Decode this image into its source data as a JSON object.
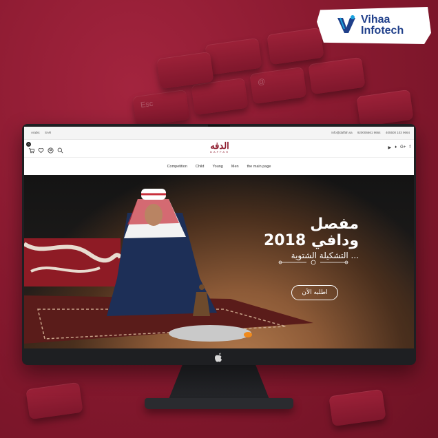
{
  "brand": {
    "line1": "Vihaa",
    "line2": "Infotech",
    "colors": {
      "blue": "#1f3f8a",
      "cyan": "#1aa3df"
    }
  },
  "website": {
    "topbar": {
      "language": "Arabic",
      "currency": "SAR",
      "email": "info@daffah.sa",
      "phones": [
        "920006661 9664",
        "405500 103 9664"
      ]
    },
    "logo": {
      "arabic": "الدفه",
      "english": "DAFFAH"
    },
    "cart_count": "0",
    "header_icons": [
      "cart-icon",
      "heart-icon",
      "user-icon",
      "search-icon"
    ],
    "social_icons": [
      "youtube-icon",
      "twitter-icon",
      "google-plus-icon",
      "facebook-icon"
    ],
    "nav": [
      "Competition",
      "Child",
      "Young",
      "Men",
      "the main page"
    ],
    "hero": {
      "line1": "مفصل",
      "line2": "2018 ودافي",
      "line3": "التشكيلة الشتوية ...",
      "cta": "اطلبه الآن"
    }
  },
  "colors": {
    "background": "#8a1a30",
    "brand_red": "#8d1a2c"
  }
}
